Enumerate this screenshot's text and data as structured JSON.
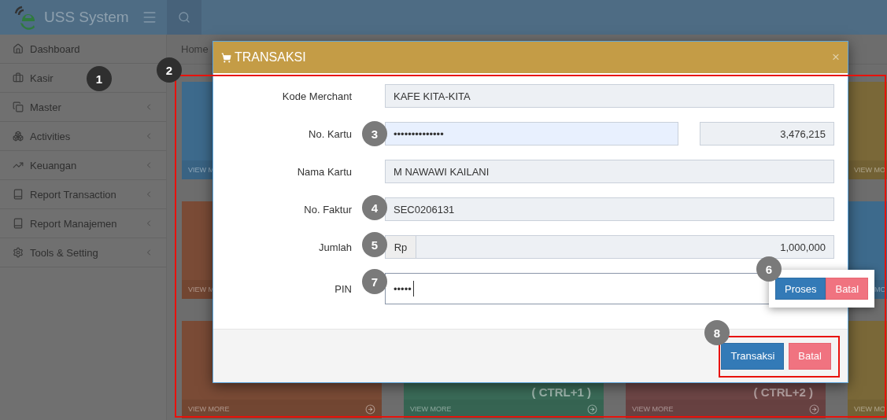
{
  "app": {
    "title": "USS System"
  },
  "sidebar": {
    "items": [
      {
        "label": "Dashboard",
        "expandable": false
      },
      {
        "label": "Kasir",
        "expandable": false
      },
      {
        "label": "Master",
        "expandable": true
      },
      {
        "label": "Activities",
        "expandable": true
      },
      {
        "label": "Keuangan",
        "expandable": true
      },
      {
        "label": "Report Transaction",
        "expandable": true
      },
      {
        "label": "Report Manajemen",
        "expandable": true
      },
      {
        "label": "Tools & Setting",
        "expandable": true
      }
    ]
  },
  "breadcrumb": "Home",
  "tile_rows": [
    [
      {
        "color": "#3d6a8c",
        "footer": "VIEW M"
      },
      {
        "color": "#7a6838",
        "footer": "VIEW MO"
      }
    ],
    [
      {
        "color": "#7a4b36",
        "footer": "VIEW M"
      },
      {
        "color": "#3d6a8c",
        "footer": "MO",
        "under_popup": true
      }
    ],
    [
      {
        "color": "#7a4b36",
        "footer": "VIEW MORE"
      },
      {
        "color": "#3a6b58",
        "shortcut": "( CTRL+1 )",
        "footer": "VIEW MORE"
      },
      {
        "color": "#6e4646",
        "shortcut": "( CTRL+2 )",
        "footer": "VIEW MORE"
      },
      {
        "color": "#7a6838",
        "footer": "VIEW MO"
      }
    ]
  ],
  "modal": {
    "title": "TRANSAKSI",
    "close": "×",
    "fields": [
      {
        "kind": "text",
        "label": "Kode Merchant",
        "value": "KAFE KITA-KITA"
      },
      {
        "kind": "card",
        "label": "No. Kartu",
        "value": "••••••••••••••",
        "balance": "3,476,215"
      },
      {
        "kind": "text",
        "label": "Nama Kartu",
        "value": "M NAWAWI KAILANI"
      },
      {
        "kind": "text",
        "label": "No. Faktur",
        "value": "SEC0206131"
      },
      {
        "kind": "amount",
        "label": "Jumlah",
        "prefix": "Rp",
        "value": "1,000,000"
      },
      {
        "kind": "pin",
        "label": "PIN",
        "value": "•••••"
      }
    ],
    "buttons": [
      {
        "label": "Transaksi",
        "kind": "primary"
      },
      {
        "label": "Batal",
        "kind": "danger"
      }
    ]
  },
  "pin_popup": {
    "buttons": [
      {
        "label": "Proses",
        "kind": "primary"
      },
      {
        "label": "Batal",
        "kind": "danger"
      }
    ]
  },
  "annotations": [
    {
      "number": "1",
      "dimmed": true
    },
    {
      "number": "2",
      "dimmed": true
    },
    {
      "number": "3",
      "dimmed": false
    },
    {
      "number": "4",
      "dimmed": false
    },
    {
      "number": "5",
      "dimmed": false
    },
    {
      "number": "6",
      "dimmed": false
    },
    {
      "number": "7",
      "dimmed": false
    },
    {
      "number": "8",
      "dimmed": false
    }
  ]
}
